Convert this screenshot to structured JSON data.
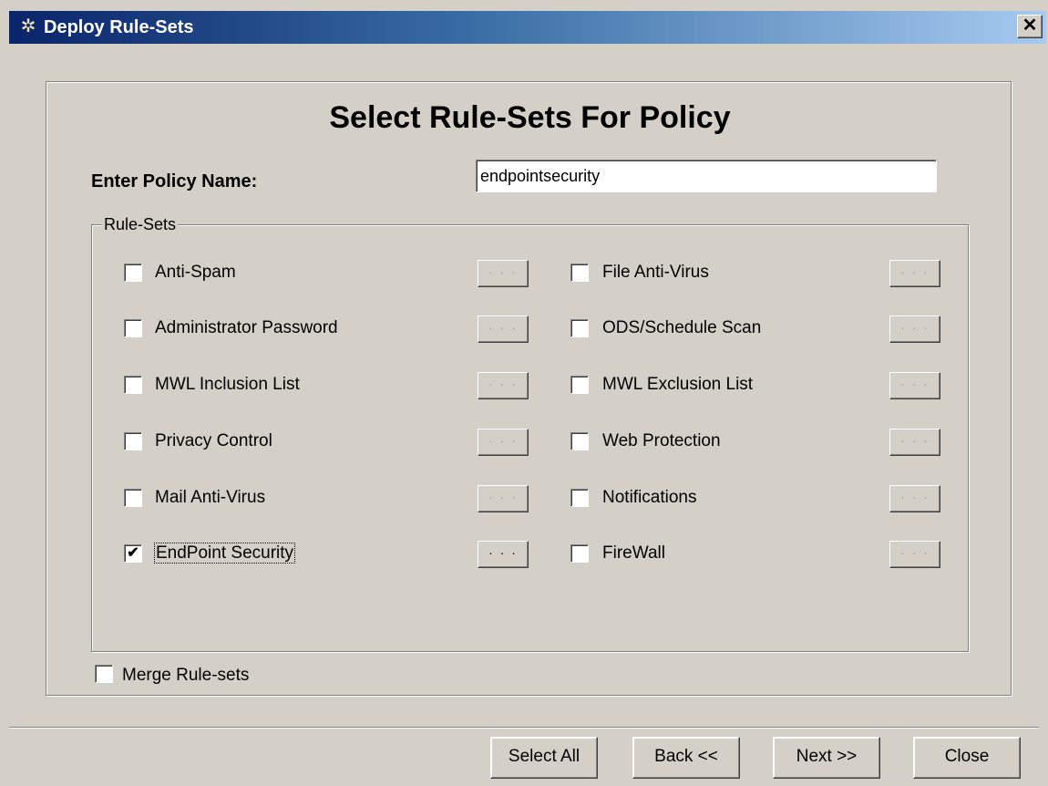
{
  "window": {
    "title": "Deploy Rule-Sets",
    "close_glyph": "✕",
    "title_icon": "gear-icon"
  },
  "heading": "Select Rule-Sets For Policy",
  "policy": {
    "label": "Enter Policy Name:",
    "value": "endpointsecurity"
  },
  "rulesets": {
    "legend": "Rule-Sets",
    "button_label": "· · ·",
    "left": [
      {
        "label": "Anti-Spam",
        "checked": false
      },
      {
        "label": "Administrator Password",
        "checked": false
      },
      {
        "label": "MWL Inclusion List",
        "checked": false
      },
      {
        "label": "Privacy Control",
        "checked": false
      },
      {
        "label": "Mail Anti-Virus",
        "checked": false
      },
      {
        "label": "EndPoint Security",
        "checked": true
      }
    ],
    "right": [
      {
        "label": "File Anti-Virus",
        "checked": false
      },
      {
        "label": "ODS/Schedule Scan",
        "checked": false
      },
      {
        "label": "MWL Exclusion List",
        "checked": false
      },
      {
        "label": "Web Protection",
        "checked": false
      },
      {
        "label": "Notifications",
        "checked": false
      },
      {
        "label": "FireWall",
        "checked": false
      }
    ]
  },
  "merge": {
    "label": "Merge Rule-sets",
    "checked": false
  },
  "buttons": {
    "select_all": "Select All",
    "back": "Back <<",
    "next": "Next >>",
    "close": "Close"
  }
}
